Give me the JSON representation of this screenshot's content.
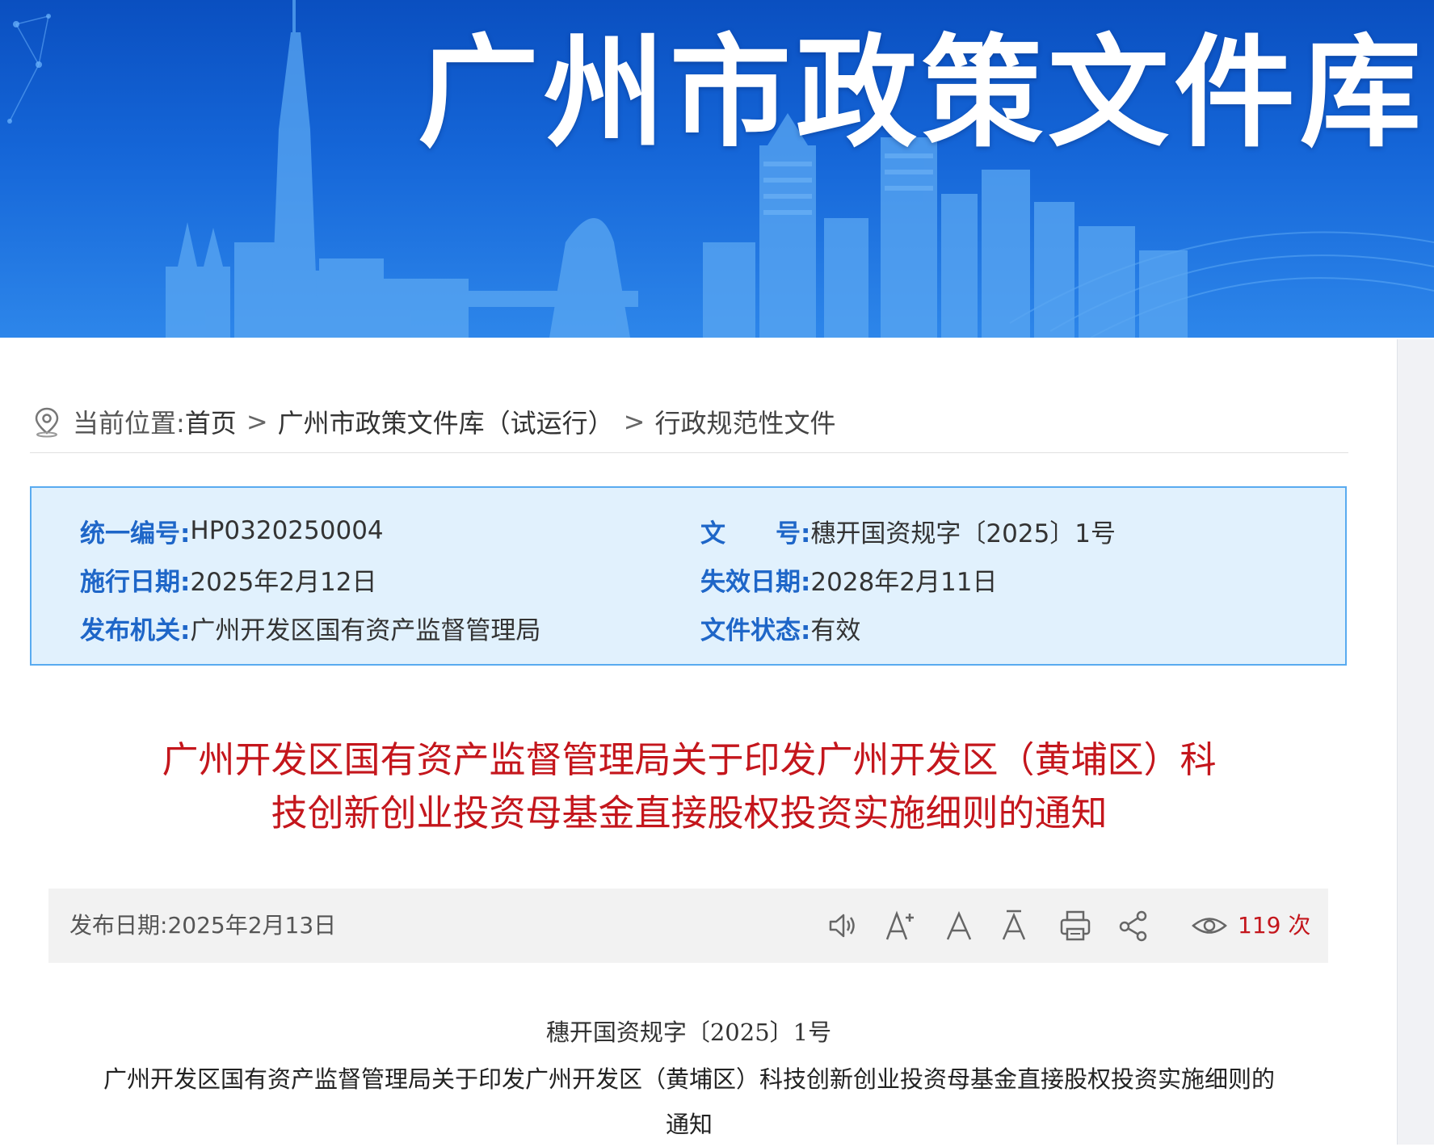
{
  "banner": {
    "title": "广州市政策文件库"
  },
  "breadcrumb": {
    "label": "当前位置:",
    "items": [
      "首页",
      "广州市政策文件库（试运行）",
      "行政规范性文件"
    ],
    "separator": ">"
  },
  "info": {
    "unified_no_label": "统一编号:",
    "unified_no": "HP0320250004",
    "doc_no_label": "文　　号:",
    "doc_no": "穗开国资规字〔2025〕1号",
    "effective_label": "施行日期:",
    "effective_date": "2025年2月12日",
    "expiry_label": "失效日期:",
    "expiry_date": "2028年2月11日",
    "issuer_label": "发布机关:",
    "issuer": "广州开发区国有资产监督管理局",
    "status_label": "文件状态:",
    "status": "有效"
  },
  "document": {
    "title": "广州开发区国有资产监督管理局关于印发广州开发区（黄埔区）科技创新创业投资母基金直接股权投资实施细则的通知",
    "title_line1": "广州开发区国有资产监督管理局关于印发广州开发区（黄埔区）科",
    "title_line2": "技创新创业投资母基金直接股权投资实施细则的通知",
    "doc_no": "穗开国资规字〔2025〕1号",
    "body_title_line1": "广州开发区国有资产监督管理局关于印发广州开发区（黄埔区）科技创新创业投资母基金直接股权投资实施细则的",
    "body_title_line2": "通知"
  },
  "meta": {
    "publish_label": "发布日期:",
    "publish_date": "2025年2月13日",
    "views": "119",
    "views_unit": "次",
    "tools": [
      "speaker-icon",
      "font-increase-icon",
      "font-default-icon",
      "font-decrease-icon",
      "print-icon",
      "share-icon",
      "eye-icon"
    ]
  },
  "colors": {
    "title_red": "#c4161c",
    "label_blue": "#1e66c8",
    "info_bg": "#e1f1fd",
    "info_border": "#59abf0",
    "banner_blue": "#1566d8"
  }
}
